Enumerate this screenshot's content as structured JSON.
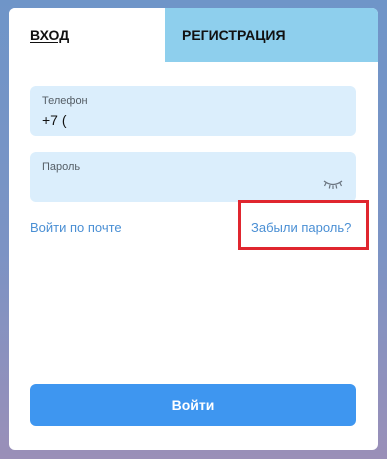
{
  "tabs": {
    "login": "ВХОД",
    "register": "РЕГИСТРАЦИЯ"
  },
  "phone": {
    "label": "Телефон",
    "value": "+7 ("
  },
  "password": {
    "label": "Пароль",
    "value": "",
    "toggle_icon": "eye-closed-icon"
  },
  "links": {
    "email_login": "Войти по почте",
    "forgot_password": "Забыли пароль?"
  },
  "submit": {
    "label": "Войти"
  },
  "colors": {
    "accent": "#3e96f0",
    "inactive_tab": "#8ecfed",
    "field_bg": "#dbeefc",
    "link": "#4a8fd4",
    "highlight": "#e0262f"
  }
}
